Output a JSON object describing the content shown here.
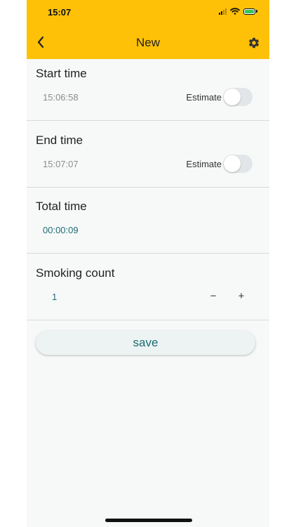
{
  "status_bar": {
    "time": "15:07"
  },
  "header": {
    "title": "New",
    "back_icon": "chevron-left-icon",
    "settings_icon": "gear-icon",
    "background": "#ffc107"
  },
  "start": {
    "label": "Start time",
    "value": "15:06:58",
    "estimate_label": "Estimate",
    "estimate_on": false
  },
  "end": {
    "label": "End time",
    "value": "15:07:07",
    "estimate_label": "Estimate",
    "estimate_on": false
  },
  "total": {
    "label": "Total time",
    "value": "00:00:09"
  },
  "smoking": {
    "label": "Smoking count",
    "value": "1",
    "minus": "−",
    "plus": "+"
  },
  "actions": {
    "save_label": "save"
  },
  "colors": {
    "accent": "#1e6b73",
    "header": "#ffc107"
  }
}
